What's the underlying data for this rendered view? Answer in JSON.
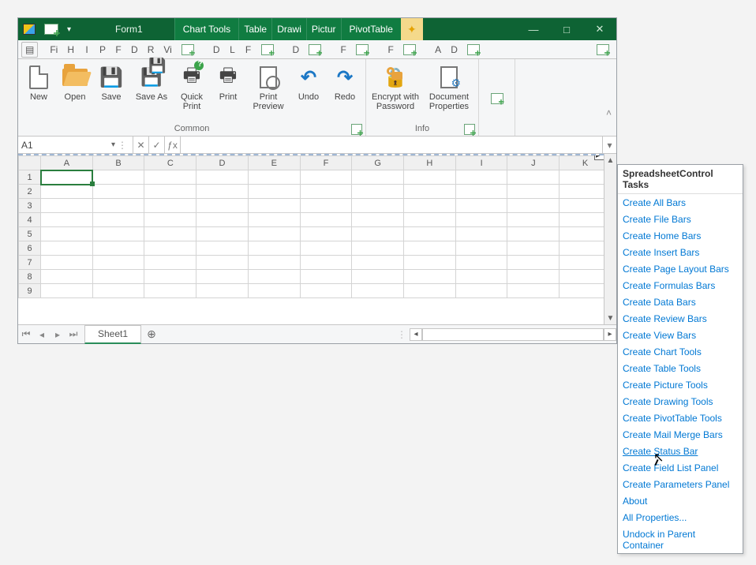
{
  "window": {
    "title": "Form1",
    "ctx_tabs": [
      "Chart Tools",
      "Table",
      "Drawi",
      "Pictur",
      "PivotTable"
    ],
    "win_buttons": {
      "minimize": "—",
      "maximize": "□",
      "close": "✕"
    }
  },
  "tabstrip": {
    "items": [
      "Fi",
      "H",
      "I",
      "P",
      "F",
      "D",
      "R",
      "Vi"
    ],
    "chart_sub": [
      "D",
      "L",
      "F"
    ],
    "table_sub": [
      "D"
    ],
    "draw_sub": [
      "F"
    ],
    "pic_sub": [
      "F"
    ],
    "pivot_sub": [
      "A",
      "D"
    ]
  },
  "ribbon": {
    "common": {
      "caption": "Common",
      "new": "New",
      "open": "Open",
      "save": "Save",
      "save_as": "Save As",
      "quick_print": "Quick Print",
      "print": "Print",
      "preview": "Print Preview",
      "undo": "Undo",
      "redo": "Redo"
    },
    "info": {
      "caption": "Info",
      "encrypt": "Encrypt with Password",
      "docprops": "Document Properties"
    }
  },
  "formula": {
    "cell_ref": "A1",
    "cancel": "✕",
    "enter": "✓",
    "fx": "ƒx"
  },
  "grid": {
    "columns": [
      "A",
      "B",
      "C",
      "D",
      "E",
      "F",
      "G",
      "H",
      "I",
      "J",
      "K"
    ],
    "rows": [
      "1",
      "2",
      "3",
      "4",
      "5",
      "6",
      "7",
      "8",
      "9"
    ],
    "selected": "A1"
  },
  "sheetbar": {
    "nav": [
      "⏮",
      "◂",
      "▸",
      "⏭"
    ],
    "tab": "Sheet1",
    "add": "⊕"
  },
  "taskpanel": {
    "title": "SpreadsheetControl Tasks",
    "links": [
      "Create All Bars",
      "Create File Bars",
      "Create Home Bars",
      "Create Insert Bars",
      "Create Page Layout Bars",
      "Create Formulas Bars",
      "Create Data Bars",
      "Create Review Bars",
      "Create View Bars",
      "Create Chart Tools",
      "Create Table Tools",
      "Create Picture Tools",
      "Create Drawing Tools",
      "Create PivotTable Tools",
      "Create Mail Merge Bars",
      "Create Status Bar",
      "Create Field List Panel",
      "Create Parameters Panel",
      "About",
      "All Properties...",
      "Undock in Parent Container"
    ],
    "hover_index": 15
  }
}
